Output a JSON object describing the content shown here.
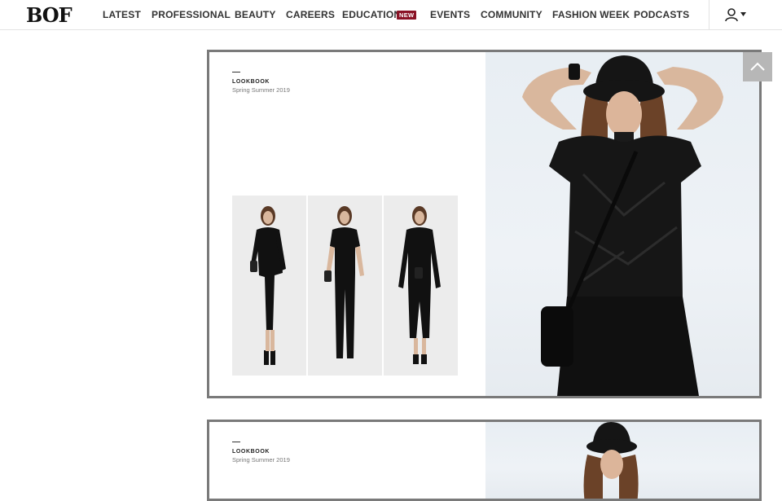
{
  "brand": {
    "logo_text": "BOF"
  },
  "nav": {
    "items": [
      {
        "label": "LATEST"
      },
      {
        "label": "PROFESSIONAL"
      },
      {
        "label": "BEAUTY"
      },
      {
        "label": "CAREERS"
      },
      {
        "label": "EDUCATION",
        "badge": "NEW"
      },
      {
        "label": "EVENTS"
      },
      {
        "label": "COMMUNITY"
      },
      {
        "label": "FASHION WEEK"
      },
      {
        "label": "PODCASTS"
      }
    ],
    "account_icon": "user-icon",
    "account_menu_icon": "caret-down-icon"
  },
  "cards": [
    {
      "label": "LOOKBOOK",
      "season": "Spring Summer 2019",
      "hero_image": "model-black-bucket-hat-hands-on-head",
      "thumbnails": [
        "look-black-top-culottes",
        "look-black-tee-wide-trousers",
        "look-black-sweater-cropped-pants"
      ]
    },
    {
      "label": "LOOKBOOK",
      "season": "Spring Summer 2019",
      "hero_image": "model-black-bucket-hat"
    }
  ],
  "scroll_top_icon": "chevron-up-icon",
  "colors": {
    "accent_badge": "#8a1225",
    "card_border": "#7a7a7a",
    "scroll_button": "#b7b7b7",
    "hero_background": "#e9eef3"
  }
}
